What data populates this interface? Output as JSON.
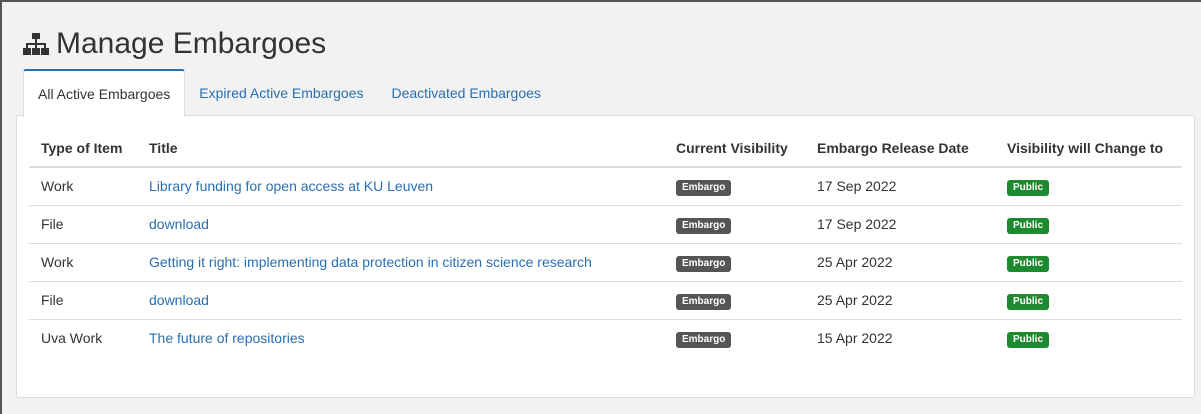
{
  "page": {
    "title": "Manage Embargoes",
    "icon": "sitemap-icon"
  },
  "tabs": [
    {
      "label": "All Active Embargoes",
      "active": true
    },
    {
      "label": "Expired Active Embargoes",
      "active": false
    },
    {
      "label": "Deactivated Embargoes",
      "active": false
    }
  ],
  "table": {
    "headers": [
      "Type of Item",
      "Title",
      "Current Visibility",
      "Embargo Release Date",
      "Visibility will Change to"
    ],
    "rows": [
      {
        "type": "Work",
        "title": "Library funding for open access at KU Leuven",
        "current": "Embargo",
        "date": "17 Sep 2022",
        "change_to": "Public"
      },
      {
        "type": "File",
        "title": "download",
        "current": "Embargo",
        "date": "17 Sep 2022",
        "change_to": "Public"
      },
      {
        "type": "Work",
        "title": "Getting it right: implementing data protection in citizen science research",
        "current": "Embargo",
        "date": "25 Apr 2022",
        "change_to": "Public"
      },
      {
        "type": "File",
        "title": "download",
        "current": "Embargo",
        "date": "25 Apr 2022",
        "change_to": "Public"
      },
      {
        "type": "Uva Work",
        "title": "The future of repositories",
        "current": "Embargo",
        "date": "15 Apr 2022",
        "change_to": "Public"
      }
    ]
  },
  "colors": {
    "link": "#2a6fb0",
    "embargo_badge": "#555555",
    "public_badge": "#1e8a2f",
    "border": "#dddddd"
  }
}
